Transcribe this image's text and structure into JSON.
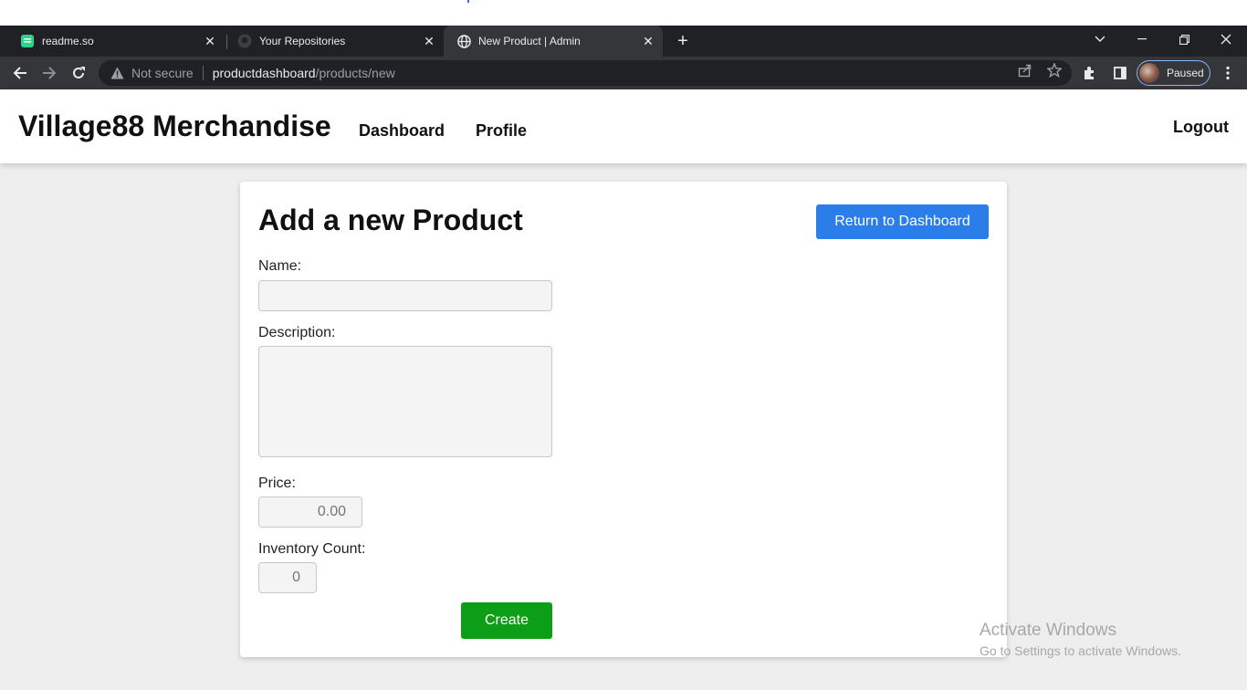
{
  "browser": {
    "tabs": [
      {
        "title": "readme.so",
        "icon": "readme-so-icon"
      },
      {
        "title": "Your Repositories",
        "icon": "github-icon"
      },
      {
        "title": "New Product | Admin",
        "icon": "globe-icon"
      }
    ],
    "new_tab": "+",
    "address": {
      "security_label": "Not secure",
      "host": "productdashboard",
      "path": "/products/new"
    },
    "profile_status": "Paused"
  },
  "navbar": {
    "brand": "Village88 Merchandise",
    "links": [
      "Dashboard",
      "Profile"
    ],
    "logout": "Logout"
  },
  "form": {
    "title": "Add a new Product",
    "return_button": "Return to Dashboard",
    "name_label": "Name:",
    "name_value": "",
    "description_label": "Description:",
    "description_value": "",
    "price_label": "Price:",
    "price_placeholder": "0.00",
    "inventory_label": "Inventory Count:",
    "inventory_placeholder": "0",
    "create_button": "Create"
  },
  "watermark": {
    "line1": "Activate Windows",
    "line2": "Go to Settings to activate Windows."
  },
  "colors": {
    "primary_button": "#2b7de9",
    "create_button": "#0d9e17",
    "page_background": "#eeeeee"
  }
}
